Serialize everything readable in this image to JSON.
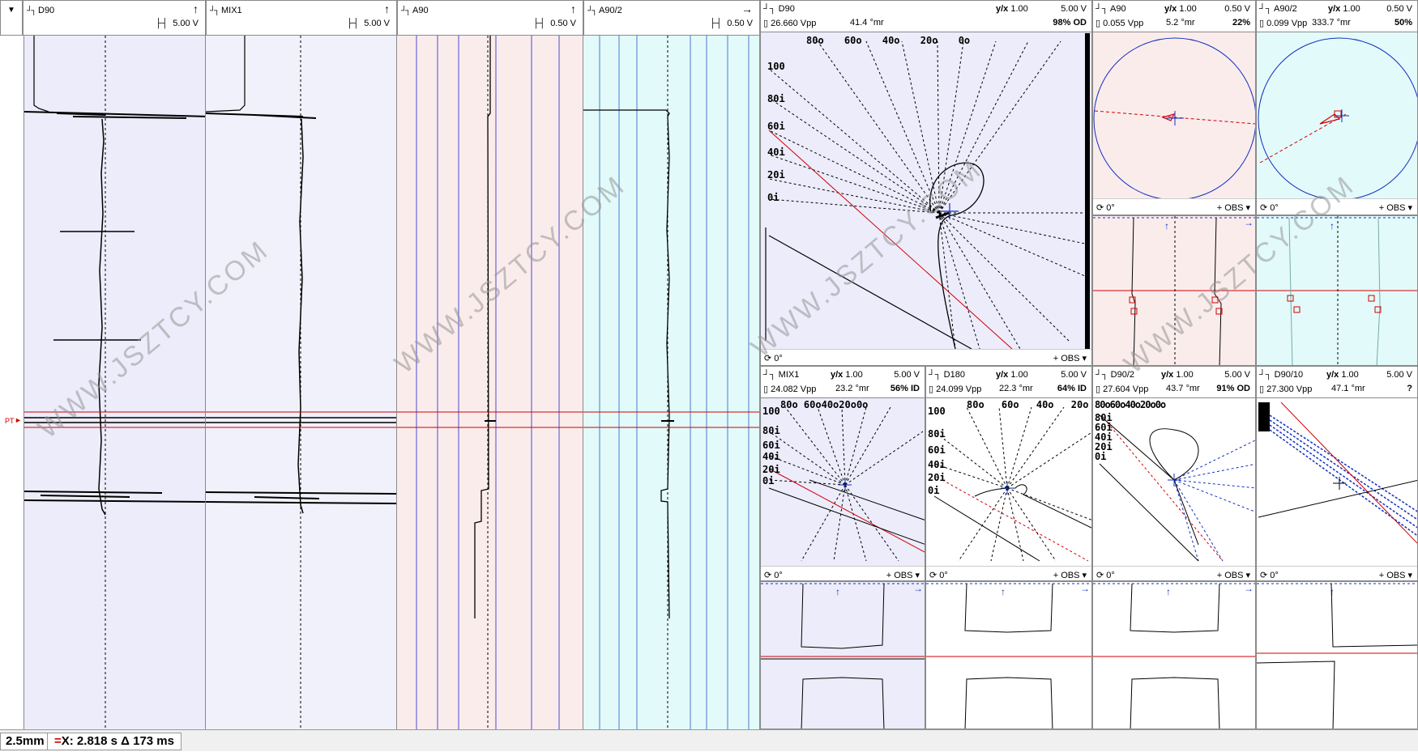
{
  "colors": {
    "purple_bg": "#ececfb",
    "pink_bg": "#fbecec",
    "cyan_bg": "#e3fafa",
    "red": "#d00000",
    "blue": "#1030c0"
  },
  "strips": [
    {
      "name": "D90",
      "scale": "5.00 V",
      "arrow": "↑"
    },
    {
      "name": "MIX1",
      "scale": "5.00 V",
      "arrow": "↑"
    },
    {
      "name": "A90",
      "scale": "0.50 V",
      "arrow": "↑"
    },
    {
      "name": "A90/2",
      "scale": "0.50 V",
      "arrow": "→"
    }
  ],
  "marker_label": "PT",
  "lissajous": [
    {
      "name": "D90",
      "ratio": "1.00",
      "volts": "5.00 V",
      "vpp": "26.660 Vpp",
      "phase": "41.4 °mr",
      "percent": "98% OD",
      "rot": "0°",
      "obs": "OBS",
      "top_labels": [
        "80o",
        "60o",
        "40o",
        "20o",
        "0o"
      ],
      "left_labels": [
        "100",
        "80i",
        "60i",
        "40i",
        "20i",
        "0i"
      ]
    },
    {
      "name": "A90",
      "ratio": "1.00",
      "volts": "0.50 V",
      "vpp": "0.055 Vpp",
      "phase": "5.2 °mr",
      "percent": "22%",
      "rot": "0°",
      "obs": "OBS"
    },
    {
      "name": "A90/2",
      "ratio": "1.00",
      "volts": "0.50 V",
      "vpp": "0.099 Vpp",
      "phase": "333.7 °mr",
      "percent": "50%",
      "rot": "0°",
      "obs": "OBS"
    },
    {
      "name": "MIX1",
      "ratio": "1.00",
      "volts": "5.00 V",
      "vpp": "24.082 Vpp",
      "phase": "23.2 °mr",
      "percent": "56% ID",
      "rot": "0°",
      "obs": "OBS",
      "top_labels": [
        "80o",
        "60o40o20o0o"
      ],
      "left_labels": [
        "100",
        "80i",
        "60i",
        "40i",
        "20i",
        "0i"
      ]
    },
    {
      "name": "D180",
      "ratio": "1.00",
      "volts": "5.00 V",
      "vpp": "24.099 Vpp",
      "phase": "22.3 °mr",
      "percent": "64% ID",
      "rot": "0°",
      "obs": "OBS",
      "top_labels": [
        "80o",
        "60o",
        "40o",
        "20o"
      ],
      "left_labels": [
        "100",
        "80i",
        "60i",
        "40i",
        "20i",
        "0i"
      ]
    },
    {
      "name": "D90/2",
      "ratio": "1.00",
      "volts": "5.00 V",
      "vpp": "27.604 Vpp",
      "phase": "43.7 °mr",
      "percent": "91% OD",
      "rot": "0°",
      "obs": "OBS",
      "top_labels": [
        "80o60o40o20o0o"
      ],
      "left_labels": [
        "80i",
        "60i",
        "40i",
        "20i",
        "0i"
      ]
    },
    {
      "name": "D90/10",
      "ratio": "1.00",
      "volts": "5.00 V",
      "vpp": "27.300 Vpp",
      "phase": "47.1 °mr",
      "percent": "?",
      "rot": "0°",
      "obs": "OBS"
    }
  ],
  "status": {
    "scale": "2.5mm",
    "eq": "=",
    "x": "X: 2.818 s Δ 173 ms"
  },
  "watermark": "WWW.JSZTCY.COM"
}
